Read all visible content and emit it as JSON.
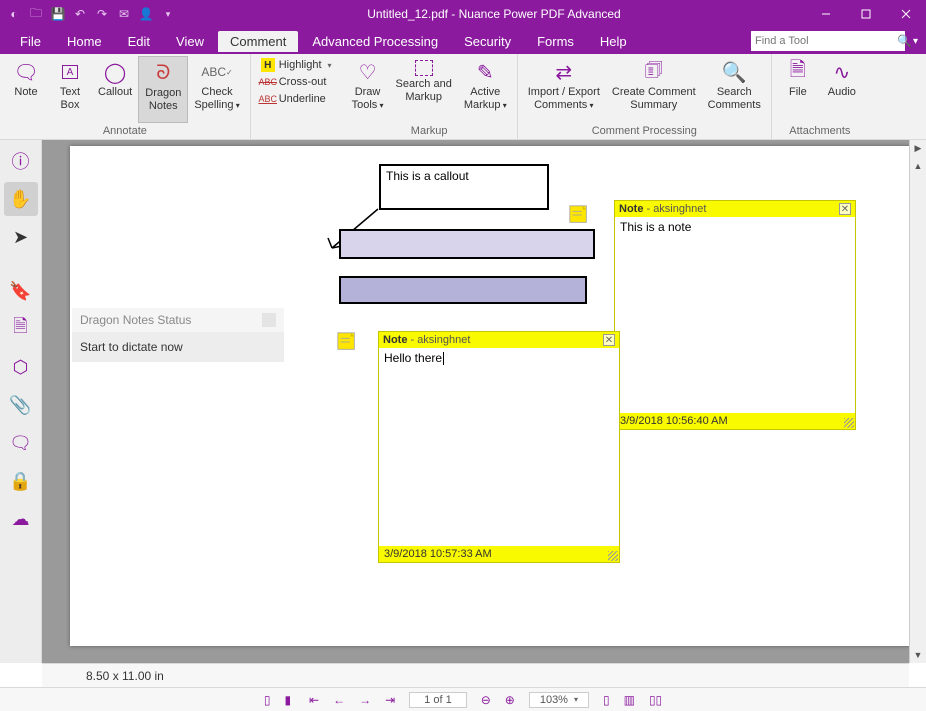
{
  "titlebar": {
    "title": "Untitled_12.pdf - Nuance Power PDF Advanced"
  },
  "menu": {
    "items": [
      "File",
      "Home",
      "Edit",
      "View",
      "Comment",
      "Advanced Processing",
      "Security",
      "Forms",
      "Help"
    ],
    "active_index": 4,
    "search_placeholder": "Find a Tool"
  },
  "ribbon": {
    "annotate": {
      "label": "Annotate",
      "note": "Note",
      "textbox": "Text\nBox",
      "callout": "Callout",
      "dragon": "Dragon\nNotes",
      "spelling": "Check\nSpelling"
    },
    "textmarkup": {
      "highlight": "Highlight",
      "crossout": "Cross-out",
      "underline": "Underline"
    },
    "markup": {
      "label": "Markup",
      "drawtools": "Draw\nTools",
      "searchmarkup": "Search and\nMarkup",
      "activemarkup": "Active\nMarkup"
    },
    "commentproc": {
      "label": "Comment Processing",
      "importexport": "Import / Export\nComments",
      "summary": "Create Comment\nSummary",
      "search": "Search\nComments"
    },
    "attachments": {
      "label": "Attachments",
      "file": "File",
      "audio": "Audio"
    }
  },
  "canvas": {
    "callout_text": "This is a callout",
    "note1": {
      "title": "Note",
      "author": "aksinghnet",
      "body": "This is a note",
      "timestamp": "3/9/2018 10:56:40 AM"
    },
    "note2": {
      "title": "Note",
      "author": "aksinghnet",
      "body": "Hello there",
      "timestamp": "3/9/2018 10:57:33 AM"
    },
    "dragon": {
      "title": "Dragon Notes Status",
      "body": "Start to dictate now"
    }
  },
  "status": {
    "dimensions": "8.50 x 11.00 in",
    "page": "1 of 1",
    "zoom": "103%"
  }
}
